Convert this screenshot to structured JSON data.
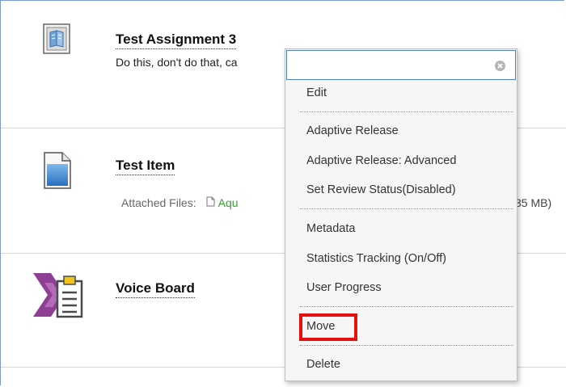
{
  "items": [
    {
      "title": "Test Assignment 3",
      "description": "Do this, don't do that, ca",
      "icon": "assignment-icon"
    },
    {
      "title": "Test Item",
      "attached_label": "Attached Files:",
      "file_name_visible": "Aqu",
      "file_size_visible": "35 MB)",
      "icon": "document-icon"
    },
    {
      "title": "Voice Board",
      "icon": "voice-board-icon"
    }
  ],
  "context_menu": {
    "search_value": "",
    "items": {
      "edit": "Edit",
      "adaptive_release": "Adaptive Release",
      "adaptive_release_advanced": "Adaptive Release: Advanced",
      "set_review_status": "Set Review Status(Disabled)",
      "metadata": "Metadata",
      "statistics_tracking": "Statistics Tracking (On/Off)",
      "user_progress": "User Progress",
      "move": "Move",
      "delete": "Delete"
    },
    "highlight_color": "#e51010"
  },
  "colors": {
    "frame_border": "#7a9ccf",
    "file_link": "#3a9b2f",
    "search_border": "#4f7fcf"
  }
}
